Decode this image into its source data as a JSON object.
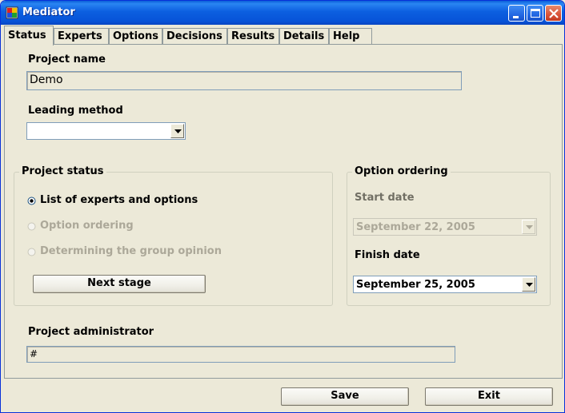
{
  "window": {
    "title": "Mediator",
    "app_icon": "mediator-app-icon"
  },
  "title_buttons": {
    "minimize": "minimize-icon",
    "maximize": "maximize-icon",
    "close": "close-icon"
  },
  "tabs": [
    {
      "label": "Status",
      "active": true
    },
    {
      "label": "Experts"
    },
    {
      "label": "Options"
    },
    {
      "label": "Decisions"
    },
    {
      "label": "Results"
    },
    {
      "label": "Details"
    },
    {
      "label": "Help"
    }
  ],
  "project": {
    "name_label": "Project name",
    "name_value": "Demo",
    "leading_method_label": "Leading method",
    "leading_method_value": ""
  },
  "project_status": {
    "title": "Project status",
    "options": [
      {
        "label": "List of experts and options",
        "selected": true,
        "enabled": true
      },
      {
        "label": "Option ordering",
        "selected": false,
        "enabled": false
      },
      {
        "label": "Determining the group opinion",
        "selected": false,
        "enabled": false
      }
    ],
    "next_stage_label": "Next stage"
  },
  "option_ordering": {
    "title": "Option ordering",
    "start_label": "Start date",
    "start_value": "September 22, 2005",
    "finish_label": "Finish date",
    "finish_value": "September 25, 2005"
  },
  "admin": {
    "label": "Project administrator",
    "value": "#"
  },
  "footer": {
    "save_label": "Save",
    "exit_label": "Exit"
  },
  "colors": {
    "window_bg": "#ece9d8",
    "titlebar": "#0753d8",
    "disabled_text": "#aca899"
  }
}
